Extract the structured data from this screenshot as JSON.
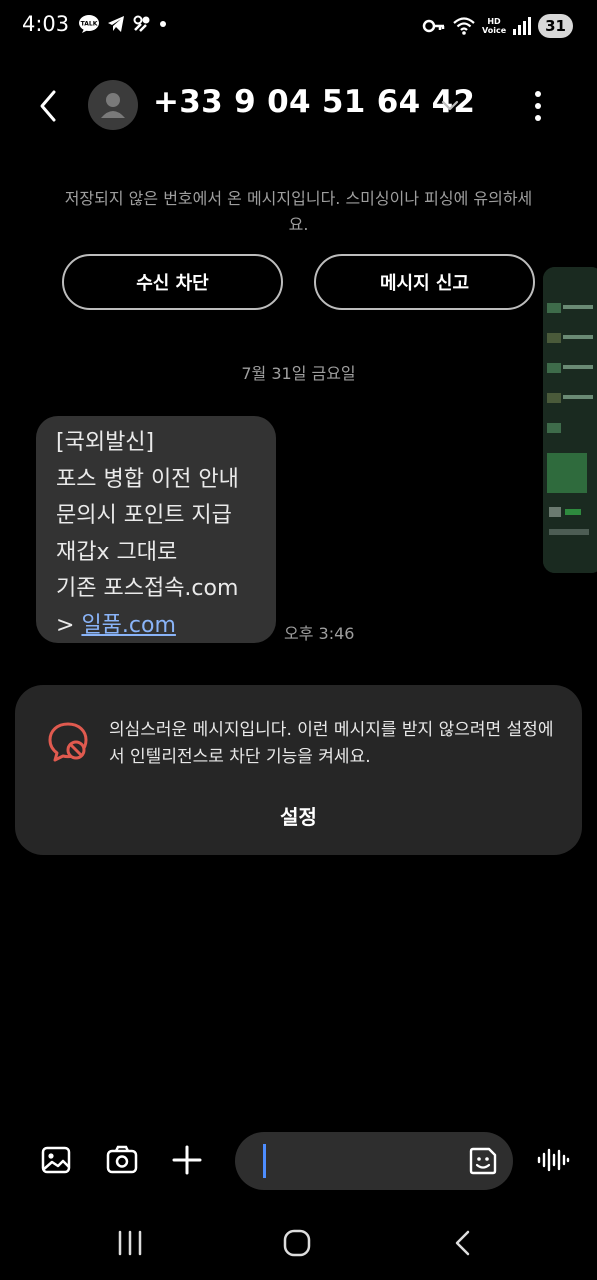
{
  "status_bar": {
    "time": "4:03",
    "left_icons": [
      "talk-icon",
      "telegram-icon",
      "pinwheel-icon",
      "dot-icon"
    ],
    "talk_badge": "TALK",
    "right_icons": [
      "key-icon",
      "wifi-icon",
      "hd-voice-icon",
      "signal-icon"
    ],
    "hd_badge_top": "HD",
    "hd_badge_bottom": "Voice",
    "battery": "31"
  },
  "header": {
    "contact": "+33 9 04 51 64 42",
    "back_icon": "back-chevron-icon",
    "menu_icon": "more-vertical-icon"
  },
  "notice": {
    "text": "저장되지 않은 번호에서 온 메시지입니다. 스미싱이나 피싱에 유의하세요.",
    "block_label": "수신 차단",
    "report_label": "메시지 신고"
  },
  "conversation": {
    "date": "7월 31일 금요일",
    "message": {
      "lines": [
        "[국외발신]",
        "포스 병합 이전 안내",
        "문의시 포인트 지급",
        "재갑x 그대로",
        "기존 포스접속.com"
      ],
      "link_prefix": "> ",
      "link": "일품.com",
      "time": "오후 3:46"
    }
  },
  "spam_card": {
    "text": "의심스러운 메시지입니다. 이런 메시지를 받지 않으려면 설정에서 인텔리전스로 차단 기능을 켜세요.",
    "button": "설정",
    "icon_color": "#e05a4f"
  },
  "composer": {
    "icons": [
      "gallery-icon",
      "camera-icon",
      "plus-icon",
      "sticker-icon",
      "voice-icon"
    ],
    "caret_color": "#4d8dff"
  },
  "nav": [
    "recents-icon",
    "home-icon",
    "back-icon"
  ]
}
